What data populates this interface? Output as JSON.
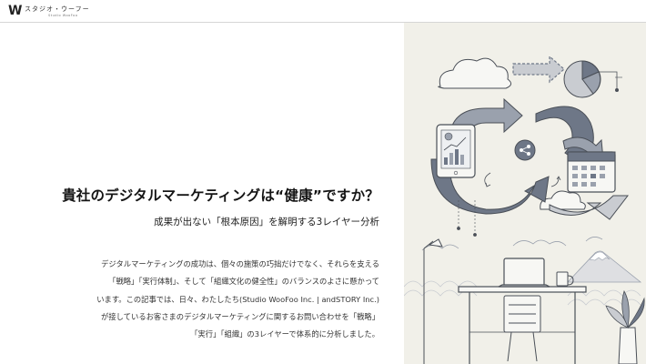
{
  "header": {
    "logo_mark": "W",
    "logo_text": "スタジオ・ウーフー",
    "logo_sub": "Studio WooFoo"
  },
  "hero": {
    "title": "貴社のデジタルマーケティングは“健康”ですか？",
    "subtitle": "成果が出ない「根本原因」を解明する3レイヤー分析",
    "body_lines": [
      "デジタルマーケティングの成功は、個々の施策の巧拙だけでなく、それらを支える",
      "「戦略」「実行体制」、そして「組織文化の健全性」のバランスのよさに懸かって",
      "います。この記事では、日々、わたしたち(Studio WooFoo Inc. | andSTORY Inc.)",
      "が接しているお客さまのデジタルマーケティングに関するお問い合わせを「戦略」",
      "「実行」「組織」の3レイヤーで体系的に分析しました。"
    ]
  },
  "illustration": {
    "background": "#f1f0e9",
    "accent_dark": "#6e7787",
    "accent_mid": "#9aa1ad",
    "accent_light": "#c9ccd1",
    "line": "#4a4f57",
    "icons": [
      "cloud-icon",
      "pie-chart-icon",
      "tablet-chart-icon",
      "share-icon",
      "calendar-icon",
      "laptop-icon",
      "mug-icon",
      "mountain-icon",
      "lamp-icon",
      "plant-icon"
    ]
  }
}
